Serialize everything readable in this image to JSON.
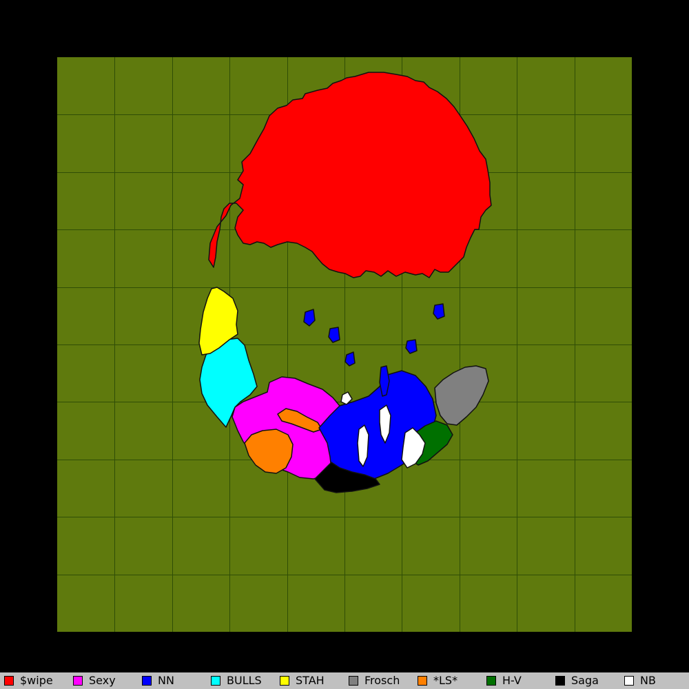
{
  "map": {
    "background": "#000000",
    "field_color": "#5f7a0d",
    "grid_color": "#2f4d06",
    "grid_cells": 10,
    "outline_color": "#111111"
  },
  "legend": {
    "background": "#c0c0c0",
    "teams": [
      {
        "name": "$wipe",
        "color": "#ff0000"
      },
      {
        "name": "Sexy",
        "color": "#ff00ff"
      },
      {
        "name": "NN",
        "color": "#0000ff"
      },
      {
        "name": "BULLS",
        "color": "#00ffff"
      },
      {
        "name": "STAH",
        "color": "#ffff00"
      },
      {
        "name": "Frosch",
        "color": "#808080"
      },
      {
        "name": "*LS*",
        "color": "#ff8000"
      },
      {
        "name": "H-V",
        "color": "#007000"
      },
      {
        "name": "Saga",
        "color": "#000000"
      },
      {
        "name": "NB",
        "color": "#ffffff"
      }
    ]
  }
}
